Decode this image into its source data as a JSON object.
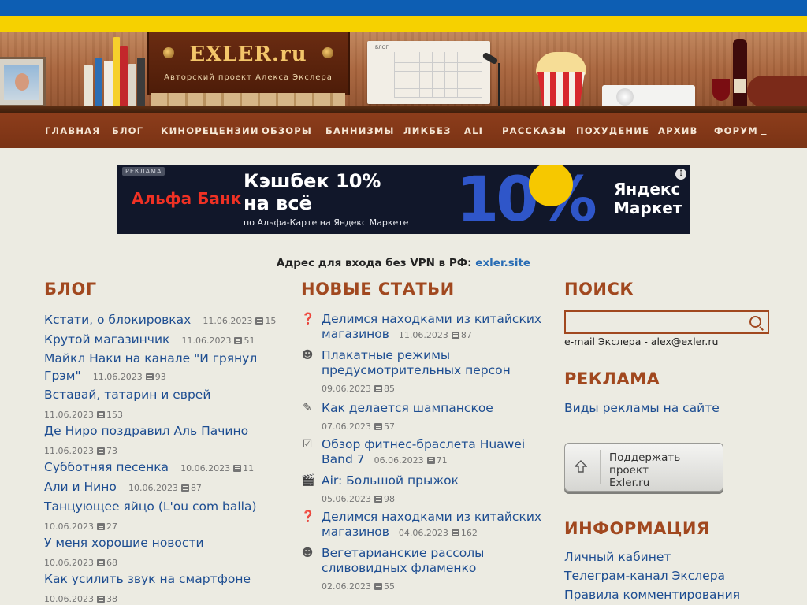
{
  "header": {
    "logo_title": "EXLER.ru",
    "logo_subtitle": "Авторский проект Алекса Экслера",
    "calendar_label": "БЛОГ"
  },
  "nav": {
    "items": [
      "Главная",
      "Блог",
      "Кинорецензии",
      "Обзоры",
      "Баннизмы",
      "Ликбез",
      "ALI",
      "Рассказы",
      "Похудение",
      "Архив",
      "Форум"
    ]
  },
  "ad": {
    "tag": "РЕКЛАМА",
    "bank": "Альфа Банк",
    "headline_1": "Кэшбек 10%",
    "headline_2": "на всё",
    "small": "по Альфа-Карте на Яндекс Маркете",
    "market_1": "Яндекс",
    "market_2": "Маркет",
    "big": "10%"
  },
  "vpn": {
    "text": "Адрес для входа без VPN в РФ:",
    "link": "exler.site"
  },
  "blog": {
    "title": "Блог",
    "items": [
      {
        "title": "Кстати, о блокировках",
        "date": "11.06.2023",
        "comments": "15"
      },
      {
        "title": "Крутой магазинчик",
        "date": "11.06.2023",
        "comments": "51"
      },
      {
        "title": "Майкл Наки на канале \"И грянул",
        "title_2": "Грэм\"",
        "date": "11.06.2023",
        "comments": "93"
      },
      {
        "title": "Вставай, татарин и еврей",
        "date": "11.06.2023",
        "comments": "153"
      },
      {
        "title": "Де Ниро поздравил Аль Пачино",
        "date": "11.06.2023",
        "comments": "73"
      },
      {
        "title": "Субботняя песенка",
        "date": "10.06.2023",
        "comments": "11"
      },
      {
        "title": "Али и Нино",
        "date": "10.06.2023",
        "comments": "87"
      },
      {
        "title": "Танцующее яйцо (L'ou com balla)",
        "date": "10.06.2023",
        "comments": "27"
      },
      {
        "title": "У меня хорошие новости",
        "date": "10.06.2023",
        "comments": "68"
      },
      {
        "title": "Как усилить звук на смартфоне",
        "date": "10.06.2023",
        "comments": "38"
      }
    ]
  },
  "articles": {
    "title": "Новые статьи",
    "items": [
      {
        "icon": "question-icon",
        "line1": "Делимся находками из китайских",
        "line2": "магазинов",
        "date": "11.06.2023",
        "comments": "87"
      },
      {
        "icon": "smile-icon",
        "line1": "Плакатные режимы",
        "line2": "предусмотрительных персон",
        "date": "09.06.2023",
        "comments": "85"
      },
      {
        "icon": "pencil-icon",
        "line1": "Как делается шампанское",
        "date": "07.06.2023",
        "comments": "57"
      },
      {
        "icon": "clipboard-check-icon",
        "line1": "Обзор фитнес-браслета Huawei",
        "line2": "Band 7",
        "date": "06.06.2023",
        "comments": "71"
      },
      {
        "icon": "film-icon",
        "line1": "Air: Большой прыжок",
        "date": "05.06.2023",
        "comments": "98"
      },
      {
        "icon": "question-icon",
        "line1": "Делимся находками из китайских",
        "line2": "магазинов",
        "date": "04.06.2023",
        "comments": "162"
      },
      {
        "icon": "smile-icon",
        "line1": "Вегетарианские рассолы",
        "line2": "сливовидных фламенко",
        "date": "02.06.2023",
        "comments": "55"
      }
    ]
  },
  "sidebar": {
    "search_title": "Поиск",
    "search_value": "",
    "email_line": "e-mail Экслера - alex@exler.ru",
    "ads_title": "Реклама",
    "ads_link": "Виды рекламы на сайте",
    "support_line1": "Поддержать проект",
    "support_line2": "Exler.ru",
    "info_title": "Информация",
    "info_links": [
      "Личный кабинет",
      "Телеграм-канал Экслера",
      "Правила комментирования"
    ]
  },
  "colors": {
    "flag_blue": "#0d5eb3",
    "flag_yellow": "#f6d100",
    "nav_bg": "#8c3d1b",
    "section_title": "#a1481f",
    "link": "#1d4d91"
  }
}
